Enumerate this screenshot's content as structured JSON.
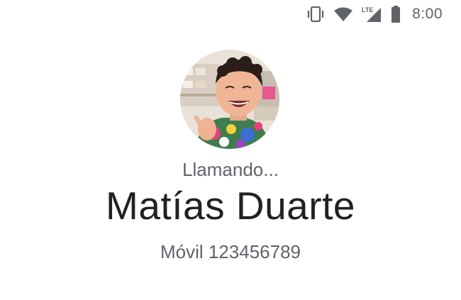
{
  "status_bar": {
    "icons": [
      "vibrate-icon",
      "wifi-icon",
      "lte-signal-icon",
      "battery-icon"
    ],
    "network_label": "LTE",
    "time": "8:00"
  },
  "call": {
    "status": "Llamando...",
    "contact_name": "Matías Duarte",
    "number_line": "Móvil 123456789"
  },
  "colors": {
    "primary_text": "#202124",
    "secondary_text": "#5f6368",
    "background": "#ffffff"
  }
}
